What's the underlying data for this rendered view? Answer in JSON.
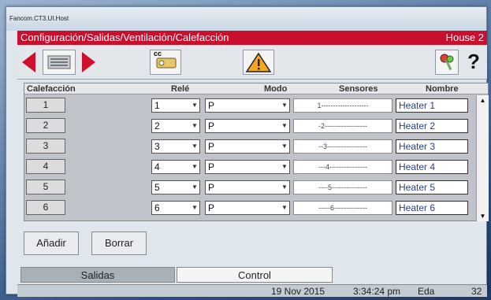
{
  "window": {
    "title": "Fancom.CT3.UI.Host"
  },
  "header": {
    "path": "Configuración/Salidas/Ventilación/Calefacción",
    "house": "House 2"
  },
  "toolbar": {
    "cc_label": "cc"
  },
  "table": {
    "columns": [
      "Calefacción",
      "Relé",
      "Modo",
      "Sensores",
      "Nombre"
    ],
    "rows": [
      {
        "num": "1",
        "rele": "1",
        "modo": "P",
        "sensores": "1--------------------",
        "nombre": "Heater 1"
      },
      {
        "num": "2",
        "rele": "2",
        "modo": "P",
        "sensores": "-2------------------",
        "nombre": "Heater 2"
      },
      {
        "num": "3",
        "rele": "3",
        "modo": "P",
        "sensores": "--3-----------------",
        "nombre": "Heater 3"
      },
      {
        "num": "4",
        "rele": "4",
        "modo": "P",
        "sensores": "---4----------------",
        "nombre": "Heater 4"
      },
      {
        "num": "5",
        "rele": "5",
        "modo": "P",
        "sensores": "----5---------------",
        "nombre": "Heater 5"
      },
      {
        "num": "6",
        "rele": "6",
        "modo": "P",
        "sensores": "-----6--------------",
        "nombre": "Heater 6"
      }
    ]
  },
  "buttons": {
    "add": "Añadir",
    "delete": "Borrar"
  },
  "tabs": [
    "Salidas",
    "Control"
  ],
  "status": {
    "date": "19 Nov 2015",
    "time": "3:34:24 pm",
    "user": "Eda",
    "num": "32"
  }
}
